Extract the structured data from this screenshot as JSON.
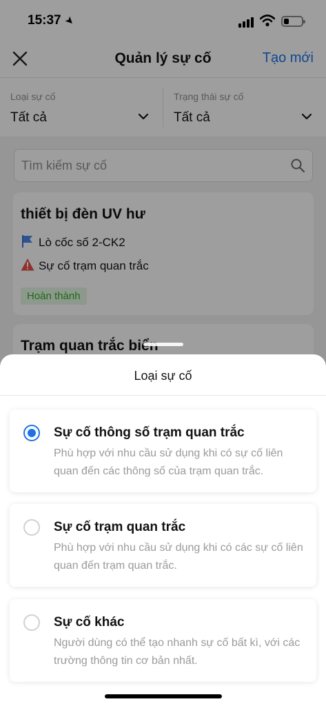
{
  "status_bar": {
    "time": "15:37"
  },
  "nav": {
    "title": "Quản lý sự cố",
    "create_label": "Tạo mới"
  },
  "filters": {
    "type": {
      "label": "Loại sự cố",
      "value": "Tất cả"
    },
    "status": {
      "label": "Trạng thái sự cố",
      "value": "Tất cả"
    }
  },
  "search": {
    "placeholder": "Tìm kiếm sự cố"
  },
  "incidents": [
    {
      "title": "thiết bị đèn UV hư",
      "location": "Lò cốc số 2-CK2",
      "type": "Sự cố trạm quan trắc",
      "status": "Hoàn thành"
    },
    {
      "title": "Trạm quan trắc biển"
    }
  ],
  "sheet": {
    "title": "Loại sự cố",
    "options": [
      {
        "title": "Sự cố thông số trạm quan trắc",
        "desc": "Phù hợp với nhu cầu sử dụng khi có sự cố liên quan đến các thông số của trạm quan trắc.",
        "selected": true
      },
      {
        "title": "Sự cố trạm quan trắc",
        "desc": "Phù hợp với nhu cầu sử dụng khi có các sự cố liên quan đến trạm quan trắc.",
        "selected": false
      },
      {
        "title": "Sự cố khác",
        "desc": "Người dùng có thể tạo nhanh sự cố bất kì, với các trường thông tin cơ bản nhất.",
        "selected": false
      }
    ]
  },
  "colors": {
    "accent": "#1a73e8",
    "status_done_bg": "#e4f7e2",
    "status_done_text": "#38a82c"
  },
  "icons": [
    "location-arrow-icon",
    "signal-icon",
    "wifi-icon",
    "battery-icon",
    "close-icon",
    "chevron-down-icon",
    "search-icon",
    "flag-icon",
    "warning-icon"
  ]
}
